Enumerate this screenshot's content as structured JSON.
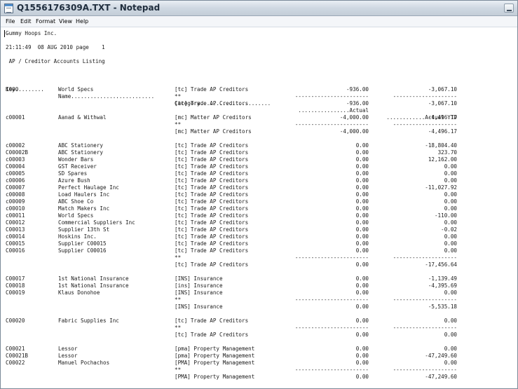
{
  "window": {
    "title": "Q1556176309A.TXT - Notepad"
  },
  "menu": [
    "File",
    "Edit",
    "Format",
    "View",
    "Help"
  ],
  "report": {
    "company": "Gummy Hoops Inc.",
    "timestamp_line": "21:11:49  08 AUG 2010 page    1",
    "report_title": " AP / Creditor Accounts Listing",
    "headers": {
      "key": "Key.........",
      "name": "Name..........................",
      "category": "Category......................",
      "actual": "................Actual",
      "ytd": "............Actual YTD"
    },
    "dash_actual": "-----------------------",
    "dash_ytd": "--------------------",
    "rows": [
      {
        "key": "1000",
        "name": "World Specs",
        "cat": "[tc] Trade AP Creditors",
        "act": "-936.00",
        "ytd": "-3,067.10"
      },
      {
        "key": "",
        "name": "",
        "cat": "**",
        "act": "-----------------------",
        "ytd": "--------------------"
      },
      {
        "key": "",
        "name": "",
        "cat": "[tc] Trade AP Creditors",
        "act": "-936.00",
        "ytd": "-3,067.10"
      },
      {
        "key": "",
        "name": "",
        "cat": "",
        "act": "",
        "ytd": ""
      },
      {
        "key": "c00001",
        "name": "Aanad & Withwal",
        "cat": "[mc] Matter AP Creditors",
        "act": "-4,000.00",
        "ytd": "-4,496.17"
      },
      {
        "key": "",
        "name": "",
        "cat": "**",
        "act": "-----------------------",
        "ytd": "--------------------"
      },
      {
        "key": "",
        "name": "",
        "cat": "[mc] Matter AP Creditors",
        "act": "-4,000.00",
        "ytd": "-4,496.17"
      },
      {
        "key": "",
        "name": "",
        "cat": "",
        "act": "",
        "ytd": ""
      },
      {
        "key": "c00002",
        "name": "ABC Stationery",
        "cat": "[tc] Trade AP Creditors",
        "act": "0.00",
        "ytd": "-18,804.40"
      },
      {
        "key": "C00002B",
        "name": "ABC Stationery",
        "cat": "[tc] Trade AP Creditors",
        "act": "0.00",
        "ytd": "323.70"
      },
      {
        "key": "c00003",
        "name": "Wonder Bars",
        "cat": "[tc] Trade AP Creditors",
        "act": "0.00",
        "ytd": "12,162.00"
      },
      {
        "key": "C00004",
        "name": "GST Receiver",
        "cat": "[tc] Trade AP Creditors",
        "act": "0.00",
        "ytd": "0.00"
      },
      {
        "key": "c00005",
        "name": "SD Spares",
        "cat": "[tc] Trade AP Creditors",
        "act": "0.00",
        "ytd": "0.00"
      },
      {
        "key": "c00006",
        "name": "Azure Bush",
        "cat": "[tc] Trade AP Creditors",
        "act": "0.00",
        "ytd": "0.00"
      },
      {
        "key": "C00007",
        "name": "Perfect Haulage Inc",
        "cat": "[tc] Trade AP Creditors",
        "act": "0.00",
        "ytd": "-11,027.92"
      },
      {
        "key": "c00008",
        "name": "Load Haulers Inc",
        "cat": "[tc] Trade AP Creditors",
        "act": "0.00",
        "ytd": "0.00"
      },
      {
        "key": "c00009",
        "name": "ABC Shoe Co",
        "cat": "[tc] Trade AP Creditors",
        "act": "0.00",
        "ytd": "0.00"
      },
      {
        "key": "c00010",
        "name": "Match Makers Inc",
        "cat": "[tc] Trade AP Creditors",
        "act": "0.00",
        "ytd": "0.00"
      },
      {
        "key": "c00011",
        "name": "World Specs",
        "cat": "[tc] Trade AP Creditors",
        "act": "0.00",
        "ytd": "-110.00"
      },
      {
        "key": "C00012",
        "name": "Commercial Suppliers Inc",
        "cat": "[tc] Trade AP Creditors",
        "act": "0.00",
        "ytd": "0.00"
      },
      {
        "key": "C00013",
        "name": "Supplier 13th St",
        "cat": "[tc] Trade AP Creditors",
        "act": "0.00",
        "ytd": "-0.02"
      },
      {
        "key": "c00014",
        "name": "Hoskins Inc.",
        "cat": "[tc] Trade AP Creditors",
        "act": "0.00",
        "ytd": "0.00"
      },
      {
        "key": "C00015",
        "name": "Supplier C00015",
        "cat": "[tc] Trade AP Creditors",
        "act": "0.00",
        "ytd": "0.00"
      },
      {
        "key": "C00016",
        "name": "Supplier C00016",
        "cat": "[tc] Trade AP Creditors",
        "act": "0.00",
        "ytd": "0.00"
      },
      {
        "key": "",
        "name": "",
        "cat": "**",
        "act": "-----------------------",
        "ytd": "--------------------"
      },
      {
        "key": "",
        "name": "",
        "cat": "[tc] Trade AP Creditors",
        "act": "0.00",
        "ytd": "-17,456.64"
      },
      {
        "key": "",
        "name": "",
        "cat": "",
        "act": "",
        "ytd": ""
      },
      {
        "key": "C00017",
        "name": "1st National Insurance",
        "cat": "[INS] Insurance",
        "act": "0.00",
        "ytd": "-1,139.49"
      },
      {
        "key": "C00018",
        "name": "1st National Insurance",
        "cat": "[ins] Insurance",
        "act": "0.00",
        "ytd": "-4,395.69"
      },
      {
        "key": "C00019",
        "name": "Klaus Donohoe",
        "cat": "[INS] Insurance",
        "act": "0.00",
        "ytd": "0.00"
      },
      {
        "key": "",
        "name": "",
        "cat": "**",
        "act": "-----------------------",
        "ytd": "--------------------"
      },
      {
        "key": "",
        "name": "",
        "cat": "[INS] Insurance",
        "act": "0.00",
        "ytd": "-5,535.18"
      },
      {
        "key": "",
        "name": "",
        "cat": "",
        "act": "",
        "ytd": ""
      },
      {
        "key": "C00020",
        "name": "Fabric Supplies Inc",
        "cat": "[tc] Trade AP Creditors",
        "act": "0.00",
        "ytd": "0.00"
      },
      {
        "key": "",
        "name": "",
        "cat": "**",
        "act": "-----------------------",
        "ytd": "--------------------"
      },
      {
        "key": "",
        "name": "",
        "cat": "[tc] Trade AP Creditors",
        "act": "0.00",
        "ytd": "0.00"
      },
      {
        "key": "",
        "name": "",
        "cat": "",
        "act": "",
        "ytd": ""
      },
      {
        "key": "C00021",
        "name": "Lessor",
        "cat": "[pma] Property Management",
        "act": "0.00",
        "ytd": "0.00"
      },
      {
        "key": "C00021B",
        "name": "Lessor",
        "cat": "[pma] Property Management",
        "act": "0.00",
        "ytd": "-47,249.60"
      },
      {
        "key": "C00022",
        "name": "Manuel Pochachos",
        "cat": "[PMA] Property Management",
        "act": "0.00",
        "ytd": "0.00"
      },
      {
        "key": "",
        "name": "",
        "cat": "**",
        "act": "-----------------------",
        "ytd": "--------------------"
      },
      {
        "key": "",
        "name": "",
        "cat": "[PMA] Property Management",
        "act": "0.00",
        "ytd": "-47,249.60"
      }
    ]
  }
}
